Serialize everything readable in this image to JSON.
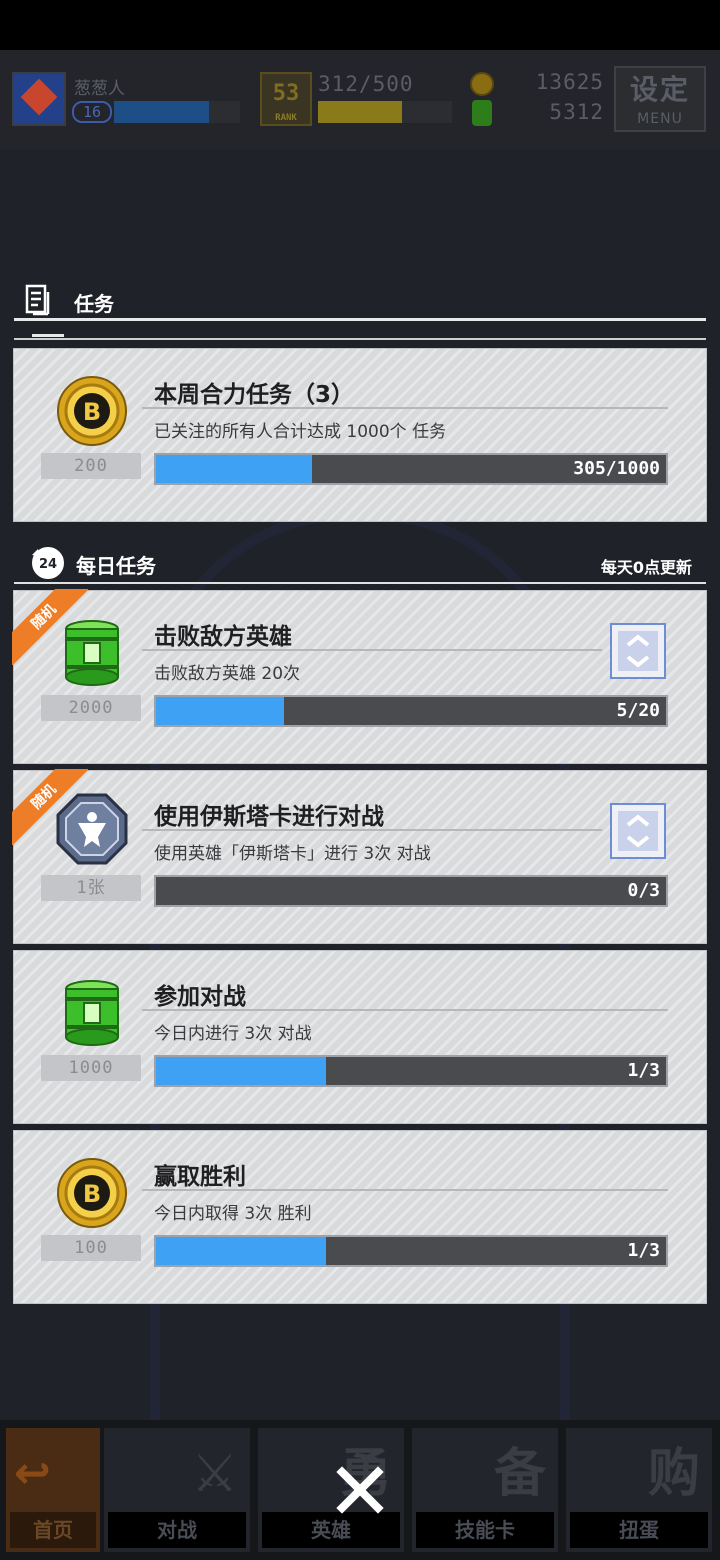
{
  "hud": {
    "player_name": "葱葱人",
    "level": "16",
    "exp_fraction": 0.75,
    "rank_value": "53",
    "rank_label": "RANK",
    "stamina": "312/500",
    "stamina_fraction": 0.624,
    "gold": "13625",
    "gems": "5312",
    "menu_big": "设定",
    "menu_small": "MENU"
  },
  "sections": {
    "tasks_title": "任务",
    "daily_title": "每日任务",
    "daily_refresh": "每天0点更新"
  },
  "weekly": {
    "title": "本周合力任务（3）",
    "desc": "已关注的所有人合计达成 1000个 任务",
    "reward_amount": "200",
    "reward_icon": "gold-coin-icon",
    "progress_label": "305/1000",
    "progress_fraction": 0.305
  },
  "daily": [
    {
      "title": "击败敌方英雄",
      "desc": "击败敌方英雄 20次",
      "reward_amount": "2000",
      "reward_icon": "green-can-icon",
      "progress_label": "5/20",
      "progress_fraction": 0.25,
      "random": "随机"
    },
    {
      "title": "使用伊斯塔卡进行对战",
      "desc": "使用英雄「伊斯塔卡」进行 3次 对战",
      "reward_amount": "1张",
      "reward_icon": "hero-card-icon",
      "progress_label": "0/3",
      "progress_fraction": 0,
      "random": "随机"
    },
    {
      "title": "参加对战",
      "desc": "今日内进行 3次 对战",
      "reward_amount": "1000",
      "reward_icon": "green-can-icon",
      "progress_label": "1/3",
      "progress_fraction": 0.333
    },
    {
      "title": "赢取胜利",
      "desc": "今日内取得 3次 胜利",
      "reward_amount": "100",
      "reward_icon": "gold-coin-icon",
      "progress_label": "1/3",
      "progress_fraction": 0.333
    }
  ],
  "nav": {
    "home": "首页",
    "battle": "对战",
    "hero": "英雄",
    "skill": "技能卡",
    "gacha": "扭蛋"
  },
  "colors": {
    "progress_fill": "#3ea1f3",
    "random_tag": "#ee7d28"
  }
}
